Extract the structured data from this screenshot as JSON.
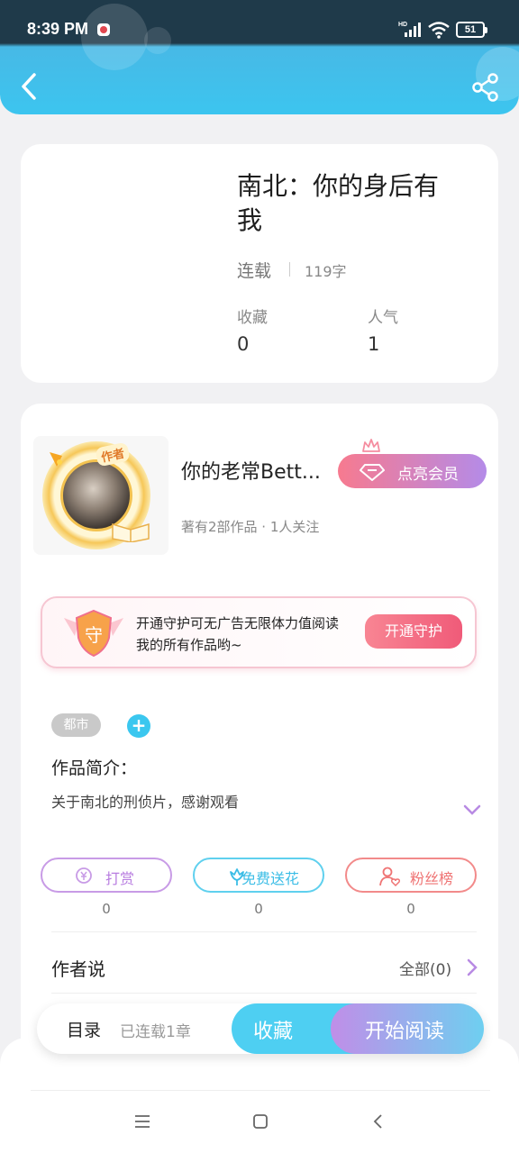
{
  "status_bar": {
    "time": "8:39 PM",
    "battery": "51"
  },
  "book": {
    "title": "南北：你的身后有我",
    "status": "连载",
    "word_count": "119字",
    "stats": [
      {
        "label": "收藏",
        "value": "0"
      },
      {
        "label": "人气",
        "value": "1"
      }
    ]
  },
  "author": {
    "avatar_badge": "作者",
    "name": "你的老常Bett...",
    "meta": "著有2部作品 · 1人关注",
    "vip_button": "点亮会员"
  },
  "guard": {
    "icon_char": "守",
    "text": "开通守护可无广告无限体力值阅读我的所有作品哟~",
    "button": "开通守护"
  },
  "tags": {
    "genre": "都市",
    "add": "+"
  },
  "intro": {
    "label": "作品简介：",
    "text": "关于南北的刑侦片，感谢观看"
  },
  "actions": [
    {
      "label": "打赏",
      "count": "0",
      "icon": "coin-icon",
      "color": "#b87de0"
    },
    {
      "label": "免费送花",
      "count": "0",
      "icon": "flower-icon",
      "color": "#3bbde6"
    },
    {
      "label": "粉丝榜",
      "count": "0",
      "icon": "fans-icon",
      "color": "#ef7474"
    }
  ],
  "author_says": {
    "label": "作者说",
    "all_link": "全部(0)"
  },
  "bottom_bar": {
    "toc_label": "目录",
    "toc_sub": "已连载1章",
    "favorite": "收藏",
    "start_reading": "开始阅读"
  },
  "colors": {
    "accent": "#3cc5ef",
    "vip_gradient_start": "#f77a8f",
    "vip_gradient_end": "#b48be8"
  }
}
